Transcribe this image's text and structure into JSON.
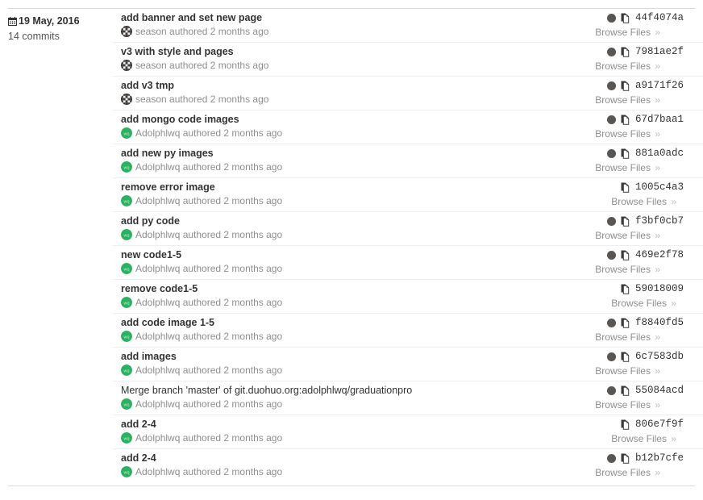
{
  "group": {
    "date_label": "19 May, 2016",
    "commit_count_label": "14 commits",
    "calendar_icon": "calendar-icon"
  },
  "labels": {
    "browse_files": "Browse Files",
    "chevron": "»",
    "copy_icon": "copy-to-clipboard-icon",
    "avatar_icon": "author-avatar"
  },
  "colors": {
    "avatar_green": "#2ab161",
    "avatar_dark": "#595552",
    "text_primary": "#333333",
    "text_muted": "#8f8f8f",
    "row_border": "#eeeeee"
  },
  "commits": [
    {
      "title": "add banner and set new page",
      "author": "season",
      "meta": "season authored 2 months ago",
      "sha": "44f4074a",
      "avatar_type": "identicon",
      "has_dot_avatar": true
    },
    {
      "title": "v3 with style and pages",
      "author": "season",
      "meta": "season authored 2 months ago",
      "sha": "7981ae2f",
      "avatar_type": "identicon",
      "has_dot_avatar": true
    },
    {
      "title": "add v3 tmp",
      "author": "season",
      "meta": "season authored 2 months ago",
      "sha": "a9171f26",
      "avatar_type": "identicon",
      "has_dot_avatar": true
    },
    {
      "title": "add mongo code images",
      "author": "Adolphlwq",
      "meta": "Adolphlwq authored 2 months ago",
      "sha": "67d7baa1",
      "avatar_type": "green",
      "has_dot_avatar": true
    },
    {
      "title": "add new py images",
      "author": "Adolphlwq",
      "meta": "Adolphlwq authored 2 months ago",
      "sha": "881a0adc",
      "avatar_type": "green",
      "has_dot_avatar": true
    },
    {
      "title": "remove error image",
      "author": "Adolphlwq",
      "meta": "Adolphlwq authored 2 months ago",
      "sha": "1005c4a3",
      "avatar_type": "green",
      "has_dot_avatar": false
    },
    {
      "title": "add py code",
      "author": "Adolphlwq",
      "meta": "Adolphlwq authored 2 months ago",
      "sha": "f3bf0cb7",
      "avatar_type": "green",
      "has_dot_avatar": true
    },
    {
      "title": "new code1-5",
      "author": "Adolphlwq",
      "meta": "Adolphlwq authored 2 months ago",
      "sha": "469e2f78",
      "avatar_type": "green",
      "has_dot_avatar": true
    },
    {
      "title": "remove code1-5",
      "author": "Adolphlwq",
      "meta": "Adolphlwq authored 2 months ago",
      "sha": "59018009",
      "avatar_type": "green",
      "has_dot_avatar": false
    },
    {
      "title": "add code image 1-5",
      "author": "Adolphlwq",
      "meta": "Adolphlwq authored 2 months ago",
      "sha": "f8840fd5",
      "avatar_type": "green",
      "has_dot_avatar": true
    },
    {
      "title": "add images",
      "author": "Adolphlwq",
      "meta": "Adolphlwq authored 2 months ago",
      "sha": "6c7583db",
      "avatar_type": "green",
      "has_dot_avatar": true
    },
    {
      "title": "Merge branch 'master' of git.duohuo.org:adolphlwq/graduationpro",
      "author": "Adolphlwq",
      "meta": "Adolphlwq authored 2 months ago",
      "sha": "55084acd",
      "avatar_type": "green",
      "has_dot_avatar": true,
      "is_merge": true
    },
    {
      "title": "add 2-4",
      "author": "Adolphlwq",
      "meta": "Adolphlwq authored 2 months ago",
      "sha": "806e7f9f",
      "avatar_type": "green",
      "has_dot_avatar": false
    },
    {
      "title": "add 2-4",
      "author": "Adolphlwq",
      "meta": "Adolphlwq authored 2 months ago",
      "sha": "b12b7cfe",
      "avatar_type": "green",
      "has_dot_avatar": true
    }
  ]
}
